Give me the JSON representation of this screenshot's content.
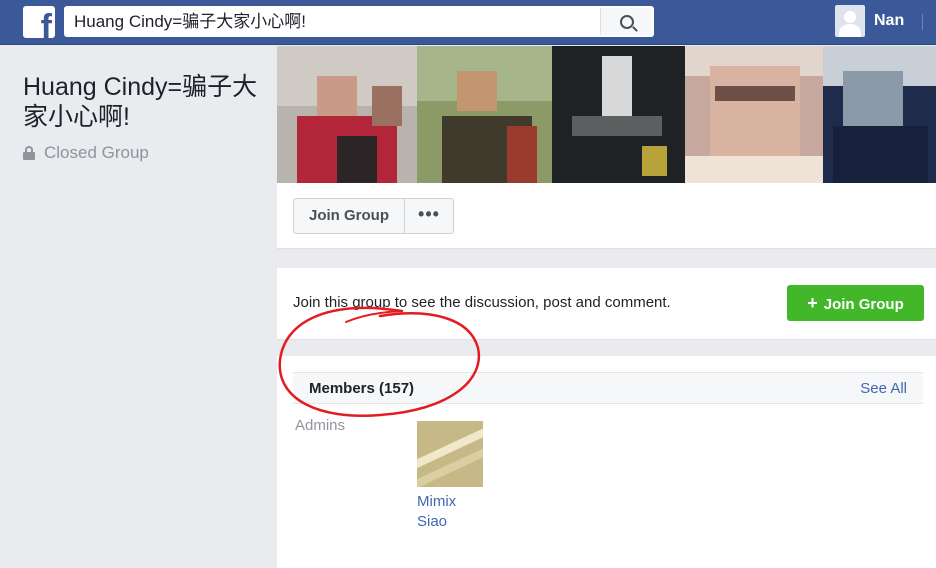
{
  "colors": {
    "brand": "#3b5998",
    "join_green": "#42b72a",
    "link": "#4267b2",
    "annotation": "#e31b23"
  },
  "topbar": {
    "logo_glyph": "f",
    "search_value": "Huang Cindy=骗子大家小心啊!",
    "search_icon": "search-icon",
    "user_name": "Nan"
  },
  "group": {
    "title": "Huang Cindy=骗子大家小心啊!",
    "privacy": "Closed Group",
    "privacy_icon": "lock-icon"
  },
  "actions": {
    "join_label": "Join Group",
    "more_label": "•••"
  },
  "join_prompt": {
    "text": "Join this group to see the discussion, post and comment.",
    "button_label": "Join Group",
    "button_icon": "plus-icon"
  },
  "members": {
    "title": "Members (157)",
    "see_all": "See All",
    "admins_label": "Admins",
    "admins": [
      {
        "name": "Mimix Siao"
      }
    ]
  }
}
